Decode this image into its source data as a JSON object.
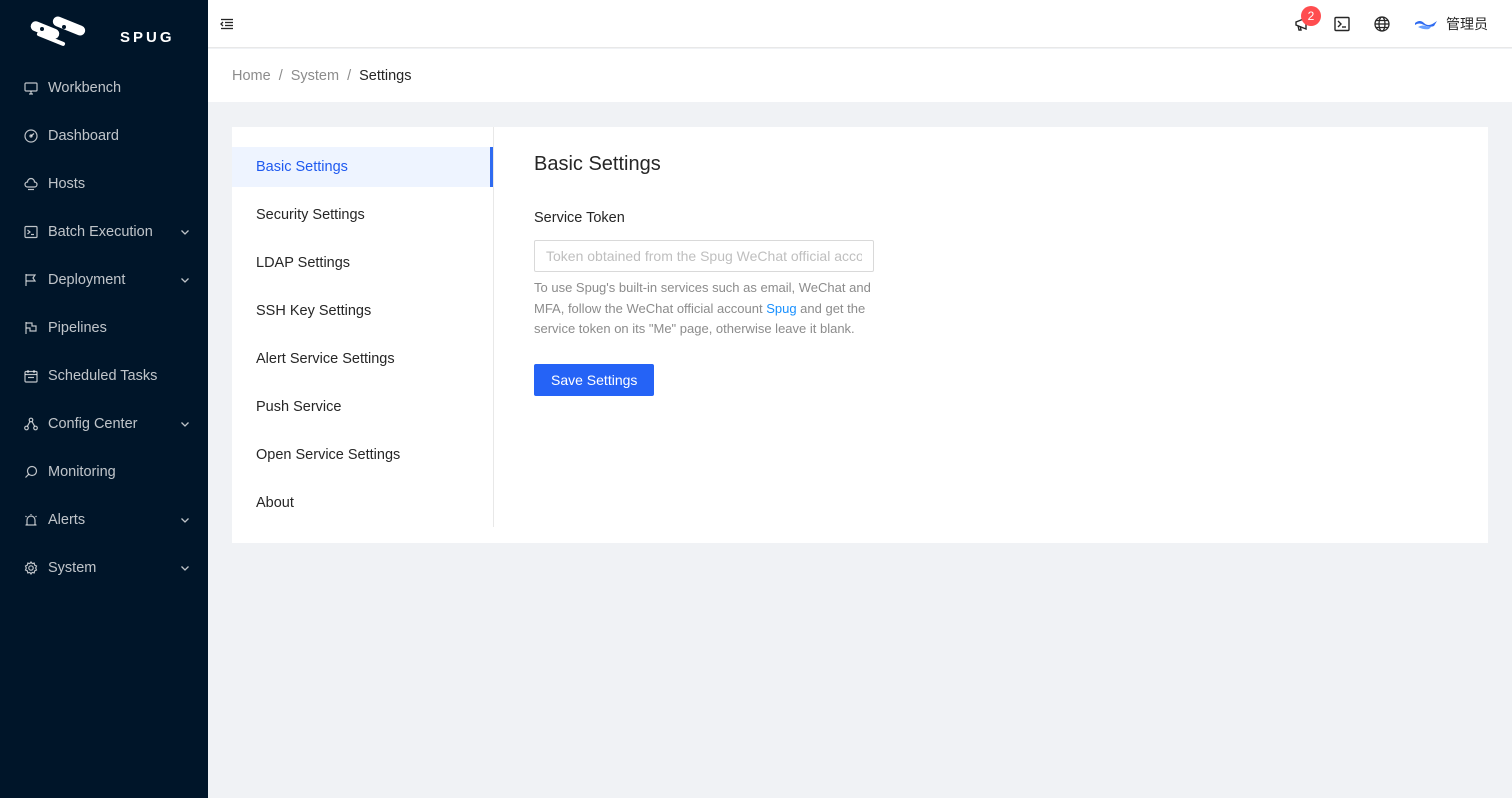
{
  "app": {
    "brand": "SPUG"
  },
  "sidebar": {
    "items": [
      {
        "label": "Workbench",
        "icon": "desktop-icon",
        "has_children": false
      },
      {
        "label": "Dashboard",
        "icon": "dashboard-icon",
        "has_children": false
      },
      {
        "label": "Hosts",
        "icon": "cloud-server-icon",
        "has_children": false
      },
      {
        "label": "Batch Execution",
        "icon": "terminal-icon",
        "has_children": true
      },
      {
        "label": "Deployment",
        "icon": "flag-icon",
        "has_children": true
      },
      {
        "label": "Pipelines",
        "icon": "pipeline-flag-icon",
        "has_children": false
      },
      {
        "label": "Scheduled Tasks",
        "icon": "schedule-icon",
        "has_children": false
      },
      {
        "label": "Config Center",
        "icon": "deployment-unit-icon",
        "has_children": true
      },
      {
        "label": "Monitoring",
        "icon": "monitor-search-icon",
        "has_children": false
      },
      {
        "label": "Alerts",
        "icon": "alert-icon",
        "has_children": true
      },
      {
        "label": "System",
        "icon": "setting-icon",
        "has_children": true
      }
    ]
  },
  "header": {
    "notification_count": "2",
    "user_name": "管理员"
  },
  "breadcrumb": [
    "Home",
    "System",
    "Settings"
  ],
  "settings_menu": [
    "Basic Settings",
    "Security Settings",
    "LDAP Settings",
    "SSH Key Settings",
    "Alert Service Settings",
    "Push Service",
    "Open Service Settings",
    "About"
  ],
  "active_settings_item": "Basic Settings",
  "basic": {
    "title": "Basic Settings",
    "token_label": "Service Token",
    "token_value": "",
    "token_placeholder": "Token obtained from the Spug WeChat official account",
    "help_before": "To use Spug's built-in services such as email, WeChat and MFA, follow the WeChat official account ",
    "help_link": "Spug",
    "help_after": " and get the service token on its \"Me\" page, otherwise leave it blank.",
    "save_label": "Save Settings"
  },
  "colors": {
    "sidebar_bg": "#001529",
    "accent": "#2563f6",
    "badge": "#ff4d4f",
    "link": "#1890ff"
  }
}
